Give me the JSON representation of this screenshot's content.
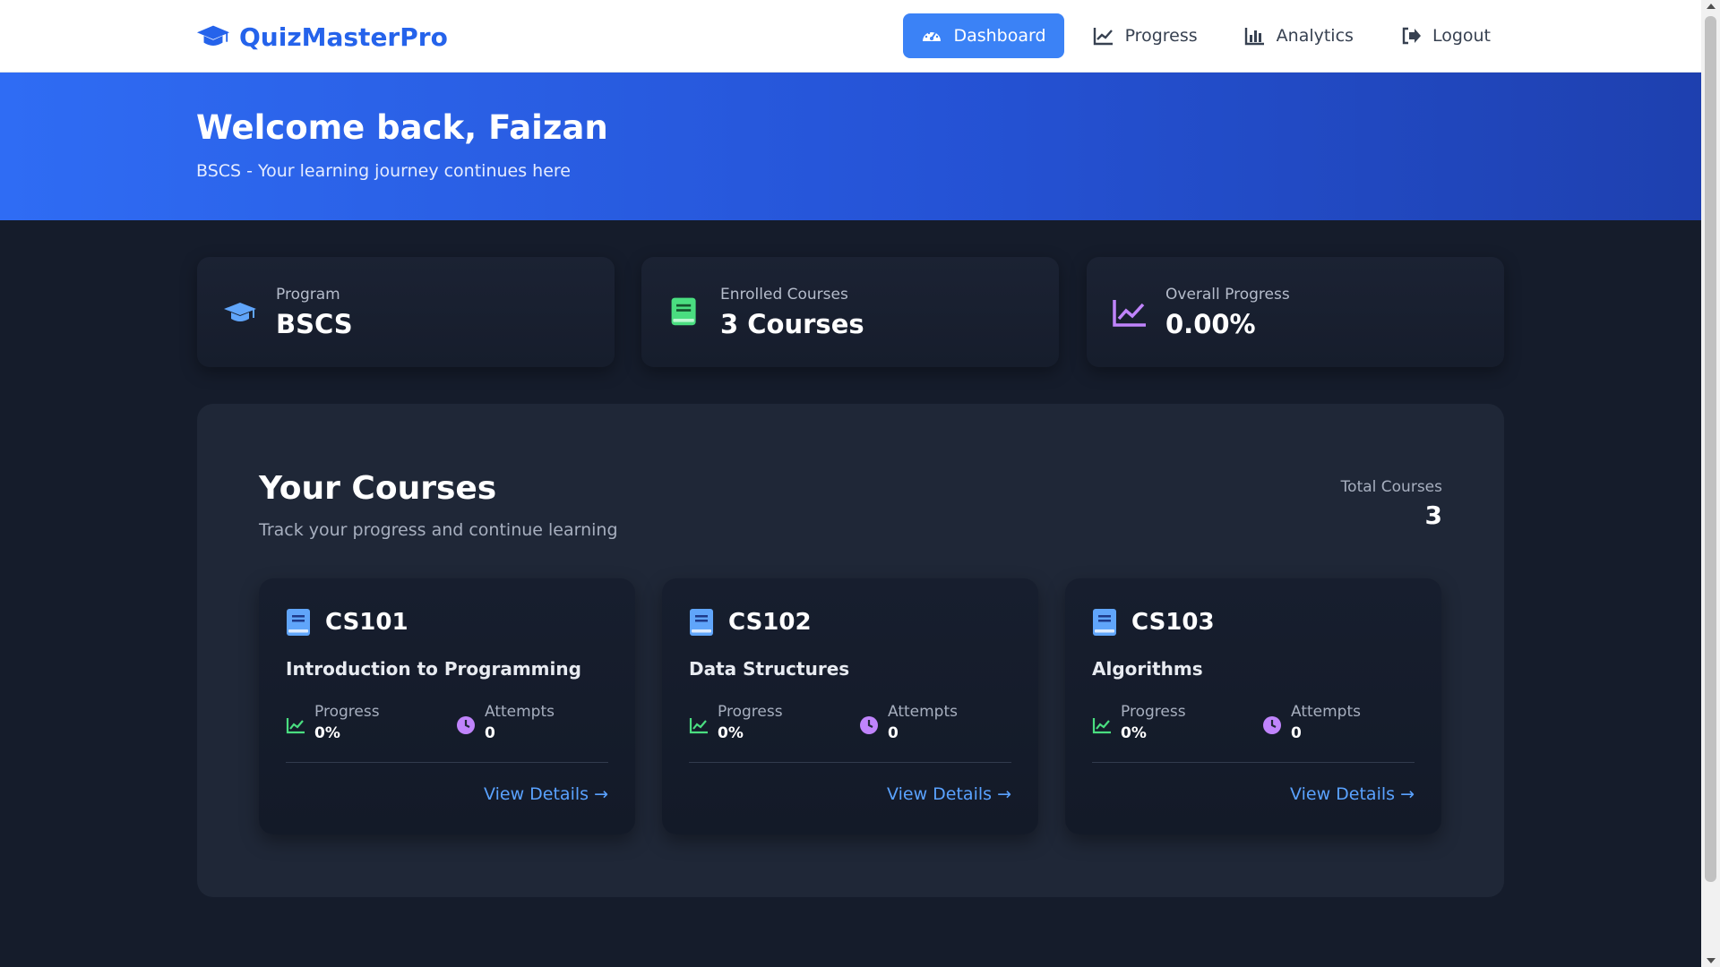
{
  "app": {
    "brand": "QuizMasterPro"
  },
  "nav": {
    "items": [
      {
        "label": "Dashboard",
        "icon": "gauge-icon",
        "active": true
      },
      {
        "label": "Progress",
        "icon": "chart-line-icon",
        "active": false
      },
      {
        "label": "Analytics",
        "icon": "bar-chart-icon",
        "active": false
      },
      {
        "label": "Logout",
        "icon": "logout-icon",
        "active": false
      }
    ]
  },
  "hero": {
    "title": "Welcome back, Faizan",
    "subtitle": "BSCS - Your learning journey continues here"
  },
  "stats": [
    {
      "label": "Program",
      "value": "BSCS",
      "icon": "graduation-cap-icon",
      "color": "#60a5fa"
    },
    {
      "label": "Enrolled Courses",
      "value": "3 Courses",
      "icon": "book-icon",
      "color": "#4ade80"
    },
    {
      "label": "Overall Progress",
      "value": "0.00%",
      "icon": "chart-line-icon",
      "color": "#c084fc"
    }
  ],
  "courses_section": {
    "title": "Your Courses",
    "subtitle": "Track your progress and continue learning",
    "total_label": "Total Courses",
    "total_value": "3"
  },
  "courses": [
    {
      "code": "CS101",
      "title": "Introduction to Programming",
      "progress_label": "Progress",
      "progress": "0%",
      "attempts_label": "Attempts",
      "attempts": "0",
      "link": "View Details →"
    },
    {
      "code": "CS102",
      "title": "Data Structures",
      "progress_label": "Progress",
      "progress": "0%",
      "attempts_label": "Attempts",
      "attempts": "0",
      "link": "View Details →"
    },
    {
      "code": "CS103",
      "title": "Algorithms",
      "progress_label": "Progress",
      "progress": "0%",
      "attempts_label": "Attempts",
      "attempts": "0",
      "link": "View Details →"
    }
  ],
  "colors": {
    "accent": "#3b82f6",
    "brand": "#2563eb",
    "progress_icon": "#4ade80",
    "attempts_icon": "#c084fc",
    "book_icon": "#60a5fa",
    "link": "#5aa2ff"
  }
}
